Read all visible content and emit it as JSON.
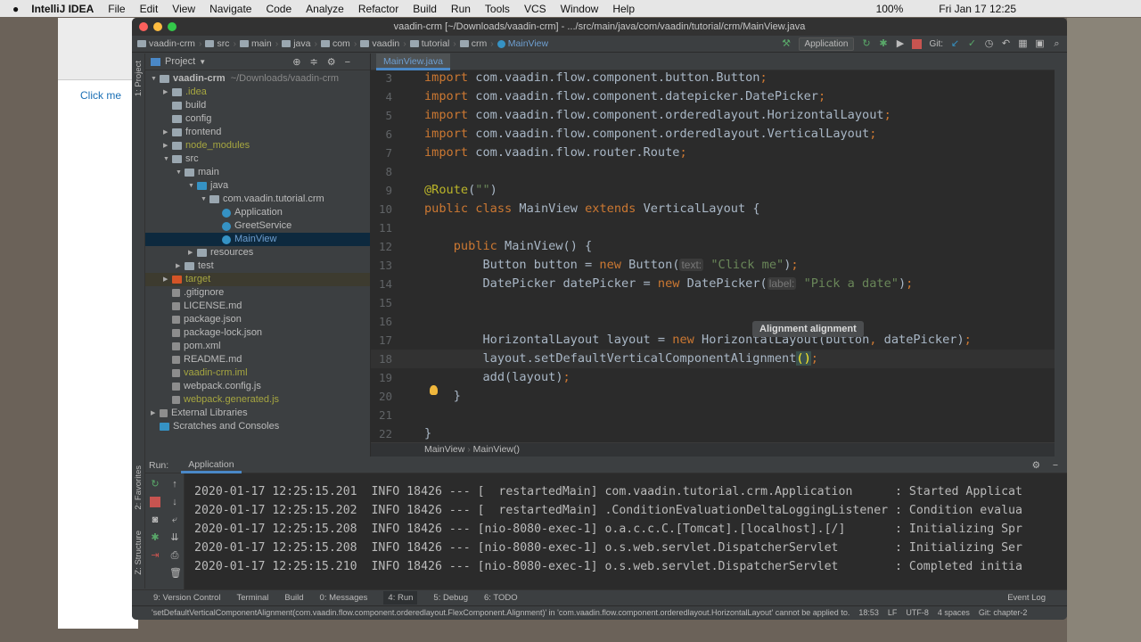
{
  "menubar": {
    "app": "IntelliJ IDEA",
    "items": [
      "File",
      "Edit",
      "View",
      "Navigate",
      "Code",
      "Analyze",
      "Refactor",
      "Build",
      "Run",
      "Tools",
      "VCS",
      "Window",
      "Help"
    ],
    "battery": "100%",
    "datetime": "Fri Jan 17  12:25"
  },
  "browser": {
    "button": "Click me"
  },
  "window": {
    "title": "vaadin-crm [~/Downloads/vaadin-crm] - .../src/main/java/com/vaadin/tutorial/crm/MainView.java"
  },
  "breadcrumb": [
    "vaadin-crm",
    "src",
    "main",
    "java",
    "com",
    "vaadin",
    "tutorial",
    "crm",
    "MainView"
  ],
  "toolbar": {
    "run_config": "Application",
    "git_label": "Git:"
  },
  "sidebar_tabs": {
    "project": "1: Project",
    "favorites": "2: Favorites",
    "structure": "Z: Structure"
  },
  "project": {
    "header": "Project",
    "tree": [
      {
        "label": "vaadin-crm",
        "extra": "~/Downloads/vaadin-crm",
        "depth": 0,
        "arrow": "open",
        "icon": "folder",
        "bold": true
      },
      {
        "label": ".idea",
        "depth": 1,
        "arrow": "closed",
        "icon": "folder",
        "olive": true
      },
      {
        "label": "build",
        "depth": 1,
        "icon": "folder"
      },
      {
        "label": "config",
        "depth": 1,
        "icon": "folder"
      },
      {
        "label": "frontend",
        "depth": 1,
        "arrow": "closed",
        "icon": "folder"
      },
      {
        "label": "node_modules",
        "depth": 1,
        "arrow": "closed",
        "icon": "folder",
        "olive": true
      },
      {
        "label": "src",
        "depth": 1,
        "arrow": "open",
        "icon": "folder"
      },
      {
        "label": "main",
        "depth": 2,
        "arrow": "open",
        "icon": "folder"
      },
      {
        "label": "java",
        "depth": 3,
        "arrow": "open",
        "icon": "blue"
      },
      {
        "label": "com.vaadin.tutorial.crm",
        "depth": 4,
        "arrow": "open",
        "icon": "folder"
      },
      {
        "label": "Application",
        "depth": 5,
        "icon": "cls"
      },
      {
        "label": "GreetService",
        "depth": 5,
        "icon": "cls"
      },
      {
        "label": "MainView",
        "depth": 5,
        "icon": "cls",
        "selected": true
      },
      {
        "label": "resources",
        "depth": 3,
        "arrow": "closed",
        "icon": "folder"
      },
      {
        "label": "test",
        "depth": 2,
        "arrow": "closed",
        "icon": "folder"
      },
      {
        "label": "target",
        "depth": 1,
        "arrow": "closed",
        "icon": "red",
        "olive": true,
        "excluded": true
      },
      {
        "label": ".gitignore",
        "depth": 1,
        "icon": "file"
      },
      {
        "label": "LICENSE.md",
        "depth": 1,
        "icon": "file"
      },
      {
        "label": "package.json",
        "depth": 1,
        "icon": "file"
      },
      {
        "label": "package-lock.json",
        "depth": 1,
        "icon": "file"
      },
      {
        "label": "pom.xml",
        "depth": 1,
        "icon": "file"
      },
      {
        "label": "README.md",
        "depth": 1,
        "icon": "file"
      },
      {
        "label": "vaadin-crm.iml",
        "depth": 1,
        "icon": "file",
        "olive": true
      },
      {
        "label": "webpack.config.js",
        "depth": 1,
        "icon": "file"
      },
      {
        "label": "webpack.generated.js",
        "depth": 1,
        "icon": "file",
        "olive": true
      },
      {
        "label": "External Libraries",
        "depth": 0,
        "arrow": "closed",
        "icon": "file"
      },
      {
        "label": "Scratches and Consoles",
        "depth": 0,
        "icon": "blue"
      }
    ]
  },
  "editor": {
    "tab": "MainView.java",
    "tooltip": "Alignment alignment",
    "breadcrumb": [
      "MainView",
      "MainView()"
    ],
    "lines": [
      {
        "n": "3",
        "t": [
          [
            "import ",
            "kw"
          ],
          [
            "com.vaadin.flow.component.button.Button",
            ""
          ],
          [
            ";",
            "kw"
          ]
        ]
      },
      {
        "n": "4",
        "t": [
          [
            "import ",
            "kw"
          ],
          [
            "com.vaadin.flow.component.datepicker.DatePicker",
            ""
          ],
          [
            ";",
            "kw"
          ]
        ]
      },
      {
        "n": "5",
        "t": [
          [
            "import ",
            "kw"
          ],
          [
            "com.vaadin.flow.component.orderedlayout.HorizontalLayout",
            ""
          ],
          [
            ";",
            "kw"
          ]
        ]
      },
      {
        "n": "6",
        "t": [
          [
            "import ",
            "kw"
          ],
          [
            "com.vaadin.flow.component.orderedlayout.VerticalLayout",
            ""
          ],
          [
            ";",
            "kw"
          ]
        ]
      },
      {
        "n": "7",
        "t": [
          [
            "import ",
            "kw"
          ],
          [
            "com.vaadin.flow.router.Route",
            ""
          ],
          [
            ";",
            "kw"
          ]
        ]
      },
      {
        "n": "8",
        "t": []
      },
      {
        "n": "9",
        "t": [
          [
            "@Route",
            "ann"
          ],
          [
            "(",
            ""
          ],
          [
            "\"\"",
            "str"
          ],
          [
            ")",
            ""
          ]
        ]
      },
      {
        "n": "10",
        "t": [
          [
            "public class ",
            "kw"
          ],
          [
            "MainView ",
            ""
          ],
          [
            "extends ",
            "kw"
          ],
          [
            "VerticalLayout {",
            ""
          ]
        ]
      },
      {
        "n": "11",
        "t": []
      },
      {
        "n": "12",
        "t": [
          [
            "    public ",
            "kw"
          ],
          [
            "MainView() {",
            ""
          ]
        ]
      },
      {
        "n": "13",
        "t": [
          [
            "        Button button = ",
            ""
          ],
          [
            "new ",
            "kw"
          ],
          [
            "Button(",
            ""
          ],
          [
            "text:",
            "hint"
          ],
          [
            "\"Click me\"",
            "str"
          ],
          [
            ")",
            ""
          ],
          [
            ";",
            "kw"
          ]
        ]
      },
      {
        "n": "14",
        "t": [
          [
            "        DatePicker datePicker = ",
            ""
          ],
          [
            "new ",
            "kw"
          ],
          [
            "DatePicker(",
            ""
          ],
          [
            "label:",
            "hint"
          ],
          [
            "\"Pick a date\"",
            "str"
          ],
          [
            ")",
            ""
          ],
          [
            ";",
            "kw"
          ]
        ]
      },
      {
        "n": "15",
        "t": []
      },
      {
        "n": "16",
        "t": []
      },
      {
        "n": "17",
        "t": [
          [
            "        HorizontalLayout layout = ",
            ""
          ],
          [
            "new ",
            "kw"
          ],
          [
            "HorizontalLayout(button",
            ""
          ],
          [
            ", ",
            "kw"
          ],
          [
            "datePicker)",
            ""
          ],
          [
            ";",
            "kw"
          ]
        ]
      },
      {
        "n": "18",
        "t": [
          [
            "        layout.setDefaultVerticalComponentAlignment",
            ""
          ],
          [
            "()",
            "paren"
          ],
          [
            ";",
            "kw"
          ]
        ],
        "current": true
      },
      {
        "n": "19",
        "t": [
          [
            "        add(layout)",
            ""
          ],
          [
            ";",
            "kw"
          ]
        ]
      },
      {
        "n": "20",
        "t": [
          [
            "    }",
            ""
          ]
        ]
      },
      {
        "n": "21",
        "t": []
      },
      {
        "n": "22",
        "t": [
          [
            "}",
            ""
          ]
        ]
      }
    ]
  },
  "run": {
    "label": "Run:",
    "tab": "Application",
    "logs": [
      "2020-01-17 12:25:15.201  INFO 18426 --- [  restartedMain] com.vaadin.tutorial.crm.Application      : Started Applicat",
      "2020-01-17 12:25:15.202  INFO 18426 --- [  restartedMain] .ConditionEvaluationDeltaLoggingListener : Condition evalua",
      "2020-01-17 12:25:15.208  INFO 18426 --- [nio-8080-exec-1] o.a.c.c.C.[Tomcat].[localhost].[/]       : Initializing Spr",
      "2020-01-17 12:25:15.208  INFO 18426 --- [nio-8080-exec-1] o.s.web.servlet.DispatcherServlet        : Initializing Ser",
      "2020-01-17 12:25:15.210  INFO 18426 --- [nio-8080-exec-1] o.s.web.servlet.DispatcherServlet        : Completed initia"
    ]
  },
  "toolwindows": [
    "9: Version Control",
    "Terminal",
    "Build",
    "0: Messages",
    "4: Run",
    "5: Debug",
    "6: TODO"
  ],
  "event_log": "Event Log",
  "status": {
    "message": "'setDefaultVerticalComponentAlignment(com.vaadin.flow.component.orderedlayout.FlexComponent.Alignment)' in 'com.vaadin.flow.component.orderedlayout.HorizontalLayout' cannot be applied to.",
    "position": "18:53",
    "line_sep": "LF",
    "encoding": "UTF-8",
    "indent": "4 spaces",
    "branch": "Git: chapter-2"
  }
}
